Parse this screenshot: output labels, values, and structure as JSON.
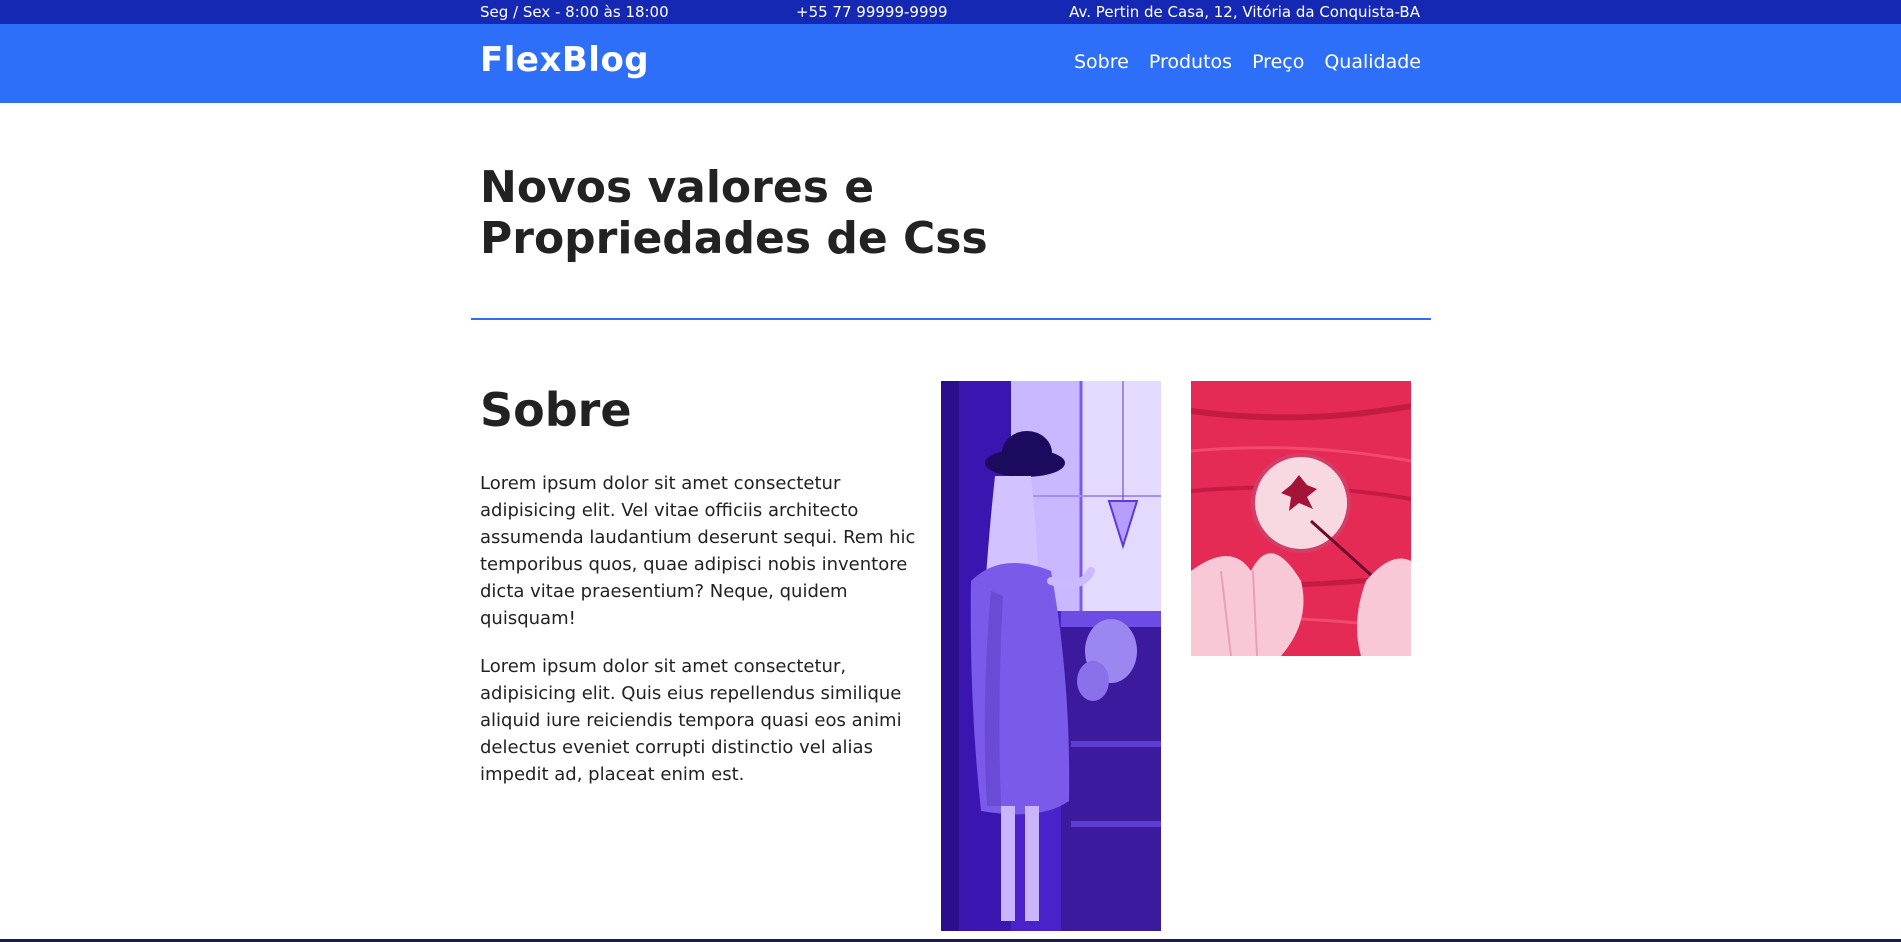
{
  "topbar": {
    "hours": "Seg / Sex - 8:00 às 18:00",
    "phone": "+55 77 99999-9999",
    "address": "Av. Pertin de Casa, 12, Vitória da Conquista-BA"
  },
  "header": {
    "brand": "FlexBlog",
    "nav": [
      {
        "label": "Sobre"
      },
      {
        "label": "Produtos"
      },
      {
        "label": "Preço"
      },
      {
        "label": "Qualidade"
      }
    ]
  },
  "hero": {
    "title_line1": "Novos valores e",
    "title_line2": "Propriedades de Css"
  },
  "about": {
    "title": "Sobre",
    "paragraphs": [
      "Lorem ipsum dolor sit amet consectetur adipisicing elit. Vel vitae officiis architecto assumenda laudantium deserunt sequi. Rem hic temporibus quos, quae adipisci nobis inventore dicta vitae praesentium? Neque, quidem quisquam!",
      "Lorem ipsum dolor sit amet consectetur, adipisicing elit. Quis eius repellendus similique aliquid iure reiciendis tempora quasi eos animi delectus eveniet corrupti distinctio vel alias impedit ad, placeat enim est."
    ]
  },
  "colors": {
    "topbar_bg": "#1428b4",
    "navbar_bg": "#2e6ffa",
    "divider": "#2e6ffa",
    "photo_tint_purple": "#5a2fd8",
    "photo_tint_red": "#e52a55"
  }
}
